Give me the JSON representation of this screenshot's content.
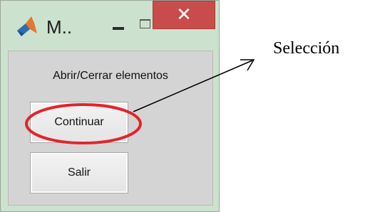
{
  "window": {
    "title": "M..",
    "close_symbol": "✕",
    "icon": "matlab-logo-icon"
  },
  "dialog": {
    "heading": "Abrir/Cerrar elementos",
    "buttons": {
      "continue_label": "Continuar",
      "exit_label": "Salir"
    }
  },
  "annotation": {
    "label": "Selección",
    "color": "#e3242b"
  }
}
